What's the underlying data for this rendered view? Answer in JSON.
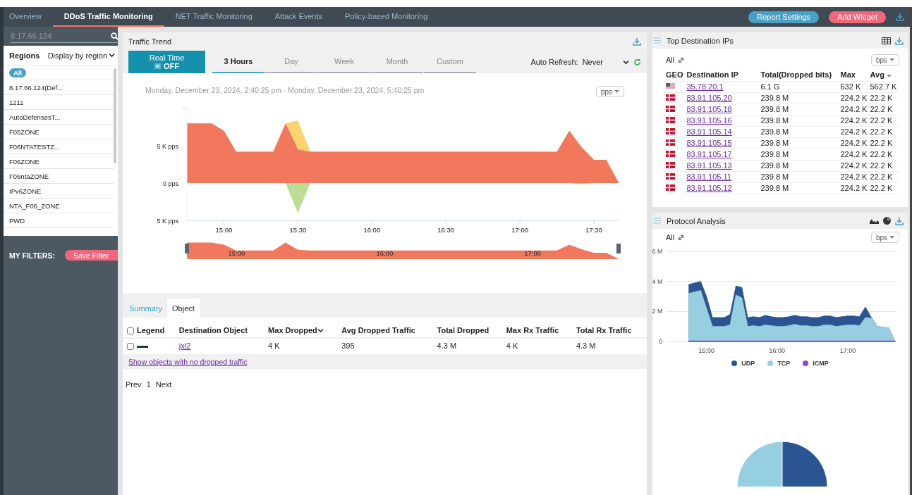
{
  "nav": {
    "tabs": [
      {
        "label": "Overview",
        "selected": false
      },
      {
        "label": "DDoS Traffic Monitoring",
        "selected": true
      },
      {
        "label": "NET Traffic Monitoring",
        "selected": false
      },
      {
        "label": "Attack Events",
        "selected": false
      },
      {
        "label": "Policy-based Monitoring",
        "selected": false
      }
    ],
    "buttons": [
      {
        "label": "Report Settings",
        "kind": "secondary"
      },
      {
        "label": "Add Widget",
        "kind": "primary"
      }
    ]
  },
  "sidebar": {
    "search": {
      "value": "8.17.66.124"
    },
    "regions_label": "Regions",
    "display_mode": "Display by region",
    "items": [
      {
        "label": "All",
        "selected": true
      },
      {
        "label": "8.17.66.124(Def...",
        "selected": false
      },
      {
        "label": "1211",
        "selected": false
      },
      {
        "label": "AutoDefensesT...",
        "selected": false
      },
      {
        "label": "F05ZONE",
        "selected": false
      },
      {
        "label": "F06NTATESTZ...",
        "selected": false
      },
      {
        "label": "F06ZONE",
        "selected": false
      },
      {
        "label": "F06ntaZONE",
        "selected": false
      },
      {
        "label": "IPv6ZONE",
        "selected": false
      },
      {
        "label": "NTA_F06_ZONE",
        "selected": false
      },
      {
        "label": "PWD",
        "selected": false
      }
    ],
    "filters_label": "MY FILTERS:",
    "save_button": "Save Filter"
  },
  "traffic_trend": {
    "title": "Traffic Trend",
    "realtime": {
      "label": "Real Time",
      "state": "OFF"
    },
    "periods": [
      {
        "label": "3 Hours",
        "selected": true
      },
      {
        "label": "Day",
        "selected": false
      },
      {
        "label": "Week",
        "selected": false
      },
      {
        "label": "Month",
        "selected": false
      },
      {
        "label": "Custom",
        "selected": false
      }
    ],
    "auto_refresh": {
      "label": "Auto Refresh:",
      "value": "Never"
    },
    "date_range": "Monday, December 23, 2024, 2:40:25 pm - Monday, December 23, 2024, 5:40:25 pm",
    "unit": "pps",
    "chart_data": {
      "type": "area",
      "stacked": false,
      "x": [
        885,
        890,
        895,
        900,
        905,
        910,
        915,
        920,
        925,
        930,
        935,
        940,
        945,
        950,
        955,
        960,
        965,
        970,
        975,
        980,
        985,
        990,
        995,
        1000,
        1005,
        1010,
        1015,
        1020,
        1025,
        1030,
        1035,
        1040,
        1045,
        1050,
        1055,
        1060
      ],
      "series": [
        {
          "color": "#fcd46e",
          "values": [
            8000,
            8000,
            8000,
            7000,
            4200,
            4200,
            4200,
            4200,
            8000,
            8400,
            4200,
            4200,
            4200,
            4200,
            4200,
            4200,
            4200,
            4200,
            4200,
            4200,
            4200,
            4200,
            4200,
            4200,
            4200,
            4200,
            4200,
            4200,
            4200,
            4200,
            4200,
            7000,
            4800,
            3100,
            3100,
            100
          ]
        },
        {
          "color": "#f1775d",
          "values": [
            8000,
            8000,
            8000,
            7000,
            4200,
            4200,
            4200,
            4200,
            8000,
            4500,
            4200,
            4200,
            4200,
            4200,
            4200,
            4200,
            4200,
            4200,
            4200,
            4200,
            4200,
            4200,
            4200,
            4200,
            4200,
            4200,
            4200,
            4200,
            4200,
            4200,
            4200,
            7000,
            4800,
            3100,
            3100,
            100
          ]
        },
        {
          "color": "#bddc96",
          "values": [
            0,
            0,
            0,
            0,
            0,
            0,
            0,
            0,
            0,
            -4000,
            0,
            0,
            0,
            0,
            0,
            0,
            0,
            0,
            0,
            0,
            0,
            0,
            0,
            0,
            0,
            0,
            0,
            0,
            0,
            0,
            0,
            0,
            -200,
            0,
            0,
            0
          ]
        }
      ],
      "xlim": [
        885,
        1060
      ],
      "ylim": [
        -5000,
        10000
      ],
      "xticks": [
        {
          "value": 900,
          "label": "15:00"
        },
        {
          "value": 930,
          "label": "15:30"
        },
        {
          "value": 960,
          "label": "16:00"
        },
        {
          "value": 990,
          "label": "16:30"
        },
        {
          "value": 1020,
          "label": "17:00"
        },
        {
          "value": 1050,
          "label": "17:30"
        }
      ],
      "yticks": [
        {
          "value": 5000,
          "label": "5 K pps"
        },
        {
          "value": 0,
          "label": "0 pps"
        },
        {
          "value": -5000,
          "label": "5 K pps"
        }
      ]
    },
    "navigator_labels": [
      "15:00",
      "16:00",
      "17:00"
    ]
  },
  "object_tabs": [
    {
      "label": "Summary",
      "selected": false
    },
    {
      "label": "Object",
      "selected": true
    }
  ],
  "object_table": {
    "columns": [
      {
        "label": "Legend",
        "sorted": false
      },
      {
        "label": "Destination Object",
        "sorted": false
      },
      {
        "label": "Max Dropped",
        "sorted": true
      },
      {
        "label": "Avg Dropped Traffic",
        "sorted": false
      },
      {
        "label": "Total Dropped",
        "sorted": false
      },
      {
        "label": "Max Rx Traffic",
        "sorted": false
      },
      {
        "label": "Total Rx Traffic",
        "sorted": false
      }
    ],
    "header_checked": false,
    "rows": [
      {
        "checked": false,
        "destination_object": "jxl2",
        "max_dropped": "4 K",
        "avg_dropped_traffic": "395",
        "total_dropped": "4.3 M",
        "max_rx_traffic": "4 K",
        "total_rx_traffic": "4.3 M"
      }
    ],
    "show_link": "Show objects with no dropped traffic",
    "pager": {
      "prev": "Prev",
      "page": "1",
      "next": "Next"
    }
  },
  "top_ips": {
    "title": "Top Destination IPs",
    "filter": "All",
    "unit": "bps",
    "columns": [
      {
        "label": "GEO",
        "sorted": false
      },
      {
        "label": "Destination IP",
        "sorted": false
      },
      {
        "label": "Total(Dropped bits)",
        "sorted": false
      },
      {
        "label": "Max",
        "sorted": false
      },
      {
        "label": "Avg",
        "sorted": true
      }
    ],
    "rows": [
      {
        "kind": "us",
        "ip": "35.78.20.1",
        "total": "6.1 G",
        "max": "632 K",
        "avg": "562.7 K"
      },
      {
        "kind": "dk",
        "ip": "83.91.105.20",
        "total": "239.8 M",
        "max": "224.2 K",
        "avg": "22.2 K"
      },
      {
        "kind": "dk",
        "ip": "83.91.105.18",
        "total": "239.8 M",
        "max": "224.2 K",
        "avg": "22.2 K"
      },
      {
        "kind": "dk",
        "ip": "83.91.105.16",
        "total": "239.8 M",
        "max": "224.2 K",
        "avg": "22.2 K"
      },
      {
        "kind": "dk",
        "ip": "83.91.105.14",
        "total": "239.8 M",
        "max": "224.2 K",
        "avg": "22.2 K"
      },
      {
        "kind": "dk",
        "ip": "83.91.105.15",
        "total": "239.8 M",
        "max": "224.2 K",
        "avg": "22.2 K"
      },
      {
        "kind": "dk",
        "ip": "83.91.105.17",
        "total": "239.8 M",
        "max": "224.2 K",
        "avg": "22.2 K"
      },
      {
        "kind": "dk",
        "ip": "83.91.105.13",
        "total": "239.8 M",
        "max": "224.2 K",
        "avg": "22.2 K"
      },
      {
        "kind": "dk",
        "ip": "83.91.105.11",
        "total": "239.8 M",
        "max": "224.2 K",
        "avg": "22.2 K"
      },
      {
        "kind": "dk",
        "ip": "83.91.105.12",
        "total": "239.8 M",
        "max": "224.2 K",
        "avg": "22.2 K"
      }
    ]
  },
  "protocol": {
    "title": "Protocol Analysis",
    "filter": "All",
    "unit": "bps",
    "chart_data": {
      "type": "area",
      "stacked": false,
      "x": [
        885,
        890,
        895,
        900,
        905,
        910,
        915,
        920,
        925,
        930,
        935,
        940,
        945,
        950,
        955,
        960,
        965,
        970,
        975,
        980,
        985,
        990,
        995,
        1000,
        1005,
        1010,
        1015,
        1020,
        1025,
        1030,
        1035,
        1040,
        1045,
        1050,
        1055,
        1060
      ],
      "series": [
        {
          "name": "UDP",
          "color": "#2b5592",
          "values": [
            3.8,
            3.9,
            4.0,
            3.0,
            1.6,
            1.6,
            1.6,
            1.8,
            3.7,
            3.6,
            1.6,
            1.65,
            1.6,
            1.75,
            1.65,
            1.6,
            1.6,
            1.65,
            1.75,
            1.65,
            1.65,
            1.6,
            1.6,
            1.7,
            1.7,
            1.6,
            1.65,
            1.7,
            1.7,
            1.65,
            2.3,
            1.6,
            1.0,
            0.95,
            0.9,
            0
          ]
        },
        {
          "name": "TCP",
          "color": "#96cfe0",
          "values": [
            3.2,
            3.3,
            3.4,
            2.2,
            1.0,
            1.0,
            1.0,
            1.1,
            3.1,
            2.9,
            1.0,
            1.05,
            1.0,
            1.1,
            1.05,
            1.0,
            1.0,
            1.05,
            1.15,
            1.05,
            1.05,
            1.0,
            1.0,
            1.1,
            1.1,
            1.0,
            1.05,
            1.1,
            1.1,
            1.05,
            1.6,
            1.55,
            1.0,
            0.95,
            0.9,
            0
          ]
        },
        {
          "name": "ICMP",
          "color": "#8a4fbf",
          "values": [
            0.03,
            0.03,
            0.03,
            0.03,
            0.03,
            0.03,
            0.03,
            0.03,
            0.03,
            0.03,
            0.03,
            0.03,
            0.03,
            0.03,
            0.03,
            0.03,
            0.03,
            0.03,
            0.03,
            0.03,
            0.03,
            0.03,
            0.03,
            0.03,
            0.03,
            0.03,
            0.03,
            0.03,
            0.03,
            0.03,
            0.03,
            0.03,
            0.03,
            0.03,
            0.03,
            0.03
          ]
        }
      ],
      "xlim": [
        866,
        1062
      ],
      "ylim": [
        0,
        6
      ],
      "xticks": [
        {
          "value": 900,
          "label": "15:00"
        },
        {
          "value": 960,
          "label": "16:00"
        },
        {
          "value": 1020,
          "label": "17:00"
        }
      ],
      "yticks": [
        {
          "value": 0,
          "label": "0"
        },
        {
          "value": 2,
          "label": "2 M"
        },
        {
          "value": 4,
          "label": "4 M"
        },
        {
          "value": 6,
          "label": "6 M"
        }
      ]
    }
  }
}
